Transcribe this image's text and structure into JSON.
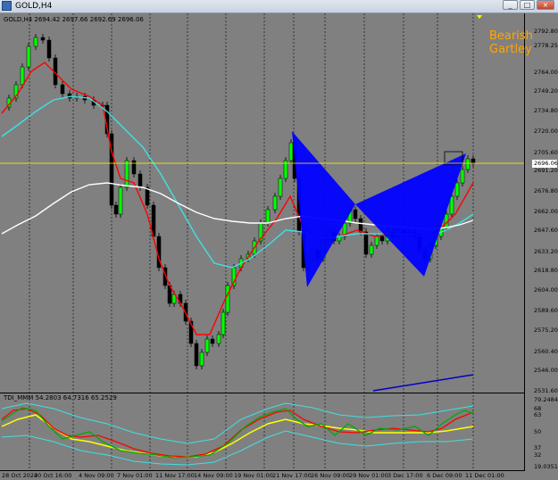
{
  "window": {
    "title": "GOLD,H4",
    "minimize_label": "_",
    "restore_label": "□",
    "close_label": "×"
  },
  "chart": {
    "ohlc_text": "GOLD,H4  2694.42 2697.66 2692.69 2696.06",
    "pattern_line1": "Bearish",
    "pattern_line2": "Gartley",
    "current_price": "2696.06"
  },
  "price_ticks": [
    "2792.80",
    "2778.25",
    "2764.00",
    "2749.20",
    "2734.80",
    "2720.00",
    "2705.60",
    "2691.20",
    "2676.80",
    "2662.00",
    "2647.60",
    "2633.20",
    "2618.80",
    "2604.00",
    "2589.60",
    "2575.20",
    "2560.40",
    "2546.00",
    "2531.60"
  ],
  "indicator": {
    "label": "TDI_MMM 54.2803 64.7316 65.2529",
    "ticks": [
      "79.2484",
      "68",
      "63",
      "50",
      "37",
      "32",
      "19.0351"
    ]
  },
  "time_labels": [
    "28 Oct 2024",
    "30 Oct 16:00",
    "4 Nov 09:00",
    "7 Nov 01:00",
    "11 Nov 17:00",
    "14 Nov 09:00",
    "19 Nov 01:00",
    "21 Nov 17:00",
    "26 Nov 09:00",
    "29 Nov 01:00",
    "3 Dec 17:00",
    "6 Dec 09:00",
    "11 Dec 01:00"
  ],
  "colors": {
    "background": "#808080",
    "bull_candle": "#00ff00",
    "bear_candle": "#000000",
    "ma_fast": "#ff0000",
    "ma_mid": "#40e0e0",
    "ma_slow": "#ffffff",
    "harmonic": "#0000ff",
    "price_line": "#ffff00",
    "pattern_text": "#ffa500"
  }
}
